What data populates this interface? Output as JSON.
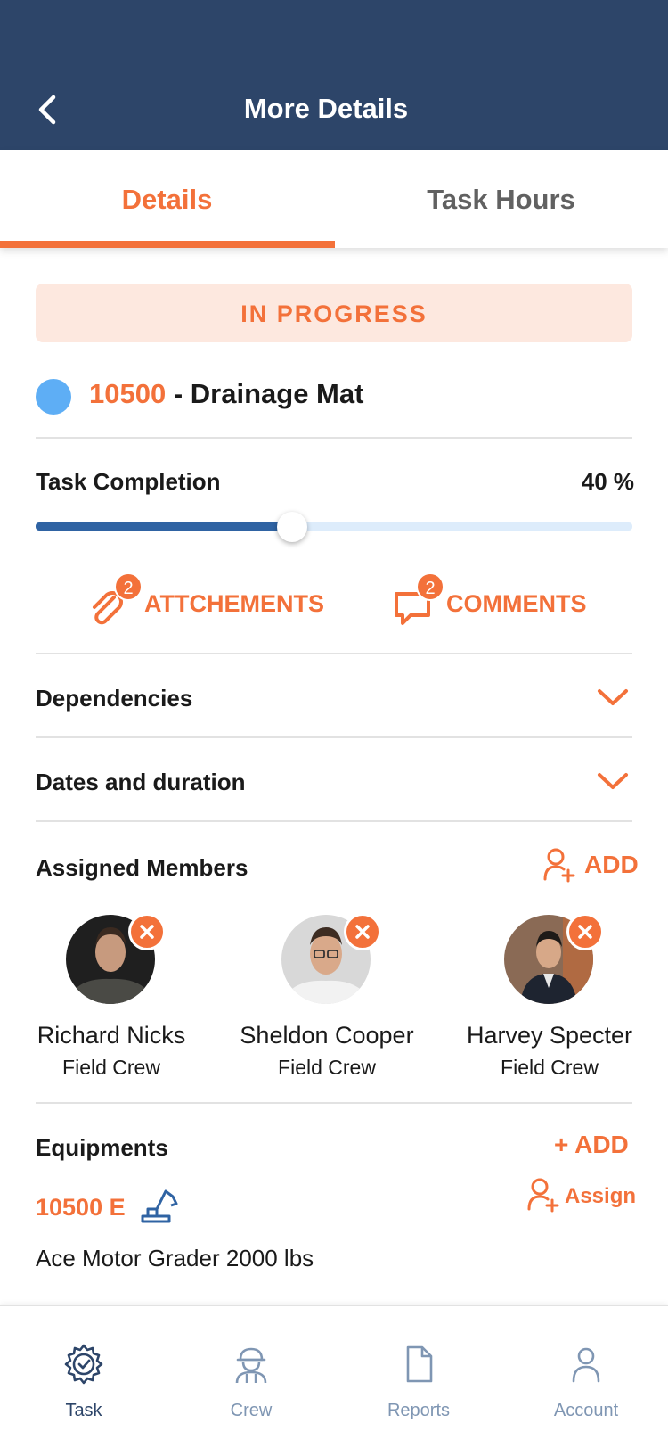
{
  "header": {
    "title": "More Details"
  },
  "tabs": [
    {
      "label": "Details",
      "active": true
    },
    {
      "label": "Task Hours",
      "active": false
    }
  ],
  "status": "IN PROGRESS",
  "task": {
    "code": "10500",
    "separator": " - ",
    "name": "Drainage Mat",
    "dot_color": "#5eaef5"
  },
  "completion": {
    "label": "Task Completion",
    "value_text": "40 %",
    "value": 0.43
  },
  "actions": {
    "attachments": {
      "label": "ATTCHEMENTS",
      "count": "2",
      "icon": "paperclip-icon"
    },
    "comments": {
      "label": "COMMENTS",
      "count": "2",
      "icon": "comment-icon"
    }
  },
  "sections": {
    "dependencies": "Dependencies",
    "dates": "Dates and duration",
    "members_title": "Assigned Members",
    "members_add": "ADD",
    "equipments_title": "Equipments",
    "equipments_add": "+ ADD"
  },
  "members": [
    {
      "name": "Richard Nicks",
      "role": "Field Crew"
    },
    {
      "name": "Sheldon Cooper",
      "role": "Field Crew"
    },
    {
      "name": "Harvey Specter",
      "role": "Field Crew"
    }
  ],
  "equipment": {
    "code": "10500 E",
    "assign_label": "Assign",
    "name": "Ace Motor Grader 2000 lbs",
    "icon": "excavator-icon"
  },
  "nav": [
    {
      "label": "Task",
      "icon": "gear-check-icon",
      "active": true
    },
    {
      "label": "Crew",
      "icon": "worker-icon",
      "active": false
    },
    {
      "label": "Reports",
      "icon": "document-icon",
      "active": false
    },
    {
      "label": "Account",
      "icon": "user-icon",
      "active": false
    }
  ],
  "colors": {
    "primary": "#2d4569",
    "accent": "#f3713a",
    "status_bg": "#fde8df"
  }
}
